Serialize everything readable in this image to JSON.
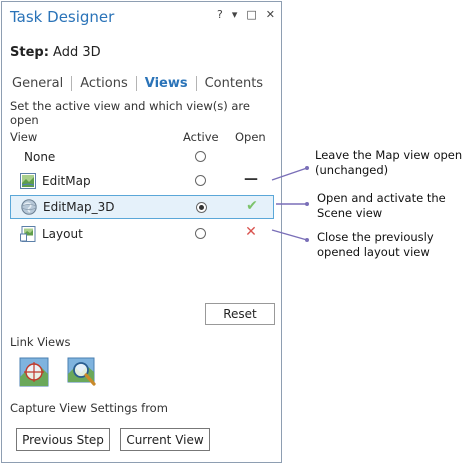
{
  "pane": {
    "title": "Task Designer",
    "icons": {
      "help": "?",
      "dropdown": "▾",
      "maximize": "□",
      "close": "✕"
    }
  },
  "step": {
    "label": "Step:",
    "name": "Add 3D"
  },
  "tabs": [
    {
      "label": "General",
      "active": false
    },
    {
      "label": "Actions",
      "active": false
    },
    {
      "label": "Views",
      "active": true
    },
    {
      "label": "Contents",
      "active": false
    }
  ],
  "views": {
    "description": "Set the active view and which view(s) are open",
    "headers": {
      "view": "View",
      "active": "Active",
      "open": "Open"
    },
    "rows": [
      {
        "name": "None",
        "icon": "none",
        "active": false,
        "open": ""
      },
      {
        "name": "EditMap",
        "icon": "map-icon",
        "active": false,
        "open": "—"
      },
      {
        "name": "EditMap_3D",
        "icon": "globe-icon",
        "active": true,
        "open": "✔"
      },
      {
        "name": "Layout",
        "icon": "layout-icon",
        "active": false,
        "open": "✕"
      }
    ],
    "reset_label": "Reset"
  },
  "link_views": {
    "label": "Link Views",
    "icons": [
      "link-center-icon",
      "link-zoom-icon"
    ]
  },
  "capture": {
    "label": "Capture View Settings from",
    "previous_step": "Previous Step",
    "current_view": "Current View"
  },
  "callouts": [
    "Leave the Map view open\n(unchanged)",
    "Open and activate the\nScene view",
    "Close the previously\nopened layout view"
  ],
  "colors": {
    "accent": "#2a73b8",
    "check": "#7cc36b",
    "close_x": "#d9534f",
    "leader": "#7a6fb8",
    "selected_border": "#5aa7d8"
  }
}
